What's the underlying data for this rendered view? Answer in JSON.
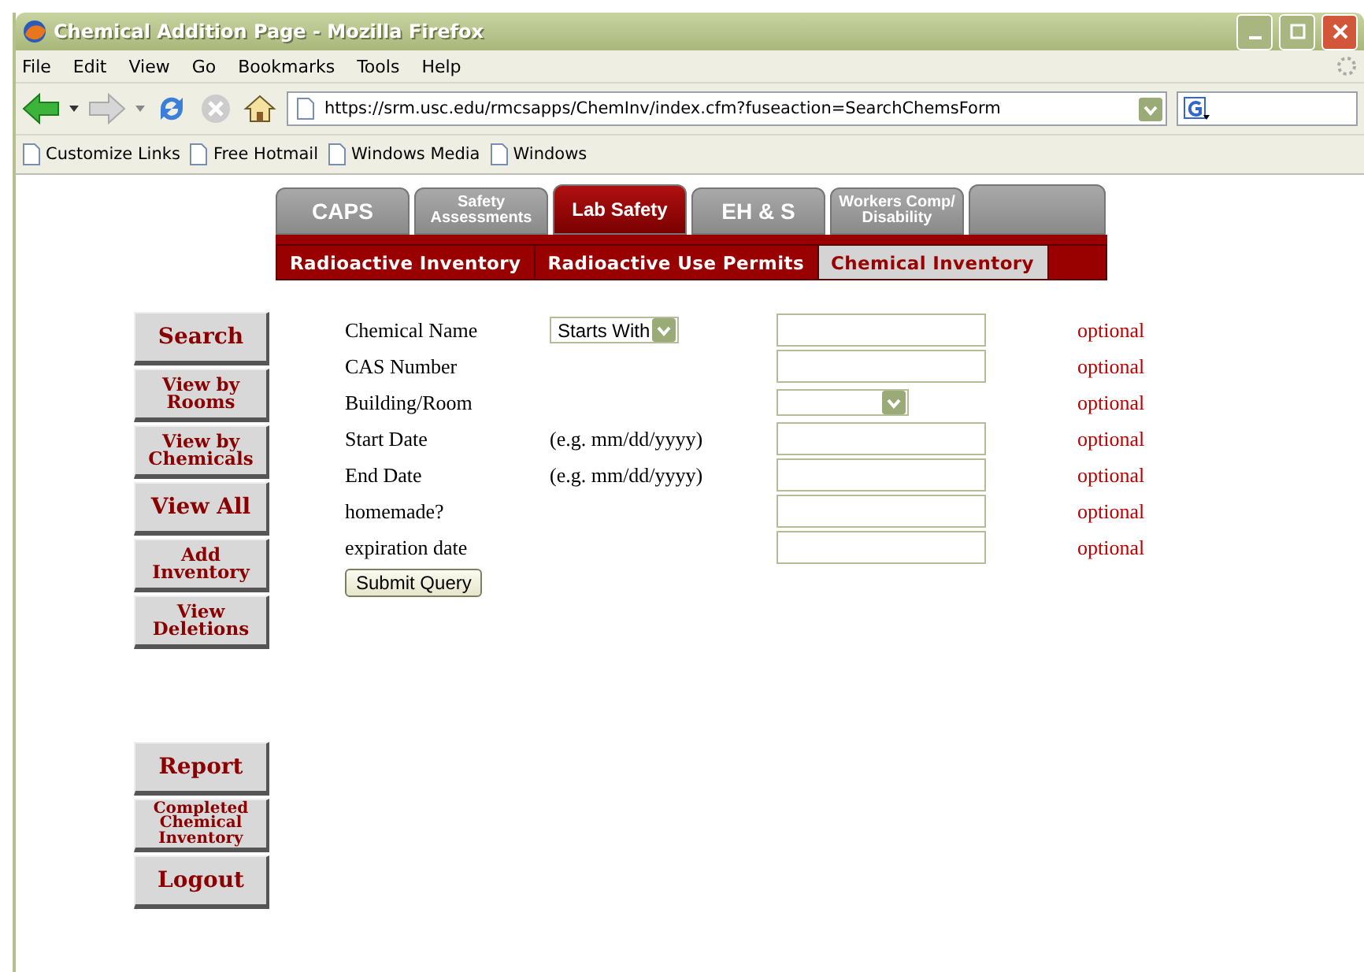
{
  "window": {
    "title": "Chemical Addition Page - Mozilla Firefox"
  },
  "menu": [
    "File",
    "Edit",
    "View",
    "Go",
    "Bookmarks",
    "Tools",
    "Help"
  ],
  "address": {
    "value": "https://srm.usc.edu/rmcsapps/ChemInv/index.cfm?fuseaction=SearchChemsForm"
  },
  "bookmarks": [
    "Customize Links",
    "Free Hotmail",
    "Windows Media",
    "Windows"
  ],
  "tabs": [
    {
      "label": "CAPS",
      "selected": false
    },
    {
      "label": "Safety Assessments",
      "selected": false
    },
    {
      "label": "Lab Safety",
      "selected": true
    },
    {
      "label": "EH & S",
      "selected": false
    },
    {
      "label": "Workers Comp/ Disability",
      "selected": false
    }
  ],
  "subtabs": [
    {
      "label": "Radioactive Inventory",
      "selected": false
    },
    {
      "label": "Radioactive Use Permits",
      "selected": false
    },
    {
      "label": "Chemical Inventory",
      "selected": true
    }
  ],
  "sidebar": {
    "top": [
      "Search",
      "View by Rooms",
      "View by Chemicals",
      "View All",
      "Add Inventory",
      "View Deletions"
    ],
    "bottom": [
      "Report",
      "Completed Chemical Inventory",
      "Logout"
    ]
  },
  "form": {
    "rows": [
      {
        "label": "Chemical Name",
        "matcher": "Starts With",
        "kind": "text",
        "note": "optional"
      },
      {
        "label": "CAS Number",
        "kind": "text",
        "note": "optional"
      },
      {
        "label": "Building/Room",
        "kind": "select",
        "note": "optional"
      },
      {
        "label": "Start Date",
        "hint": "(e.g. mm/dd/yyyy)",
        "kind": "text",
        "note": "optional"
      },
      {
        "label": "End Date",
        "hint": "(e.g. mm/dd/yyyy)",
        "kind": "text",
        "note": "optional"
      },
      {
        "label": "homemade?",
        "kind": "text",
        "note": "optional"
      },
      {
        "label": "expiration date",
        "kind": "text",
        "note": "optional"
      }
    ],
    "submit": "Submit Query"
  }
}
